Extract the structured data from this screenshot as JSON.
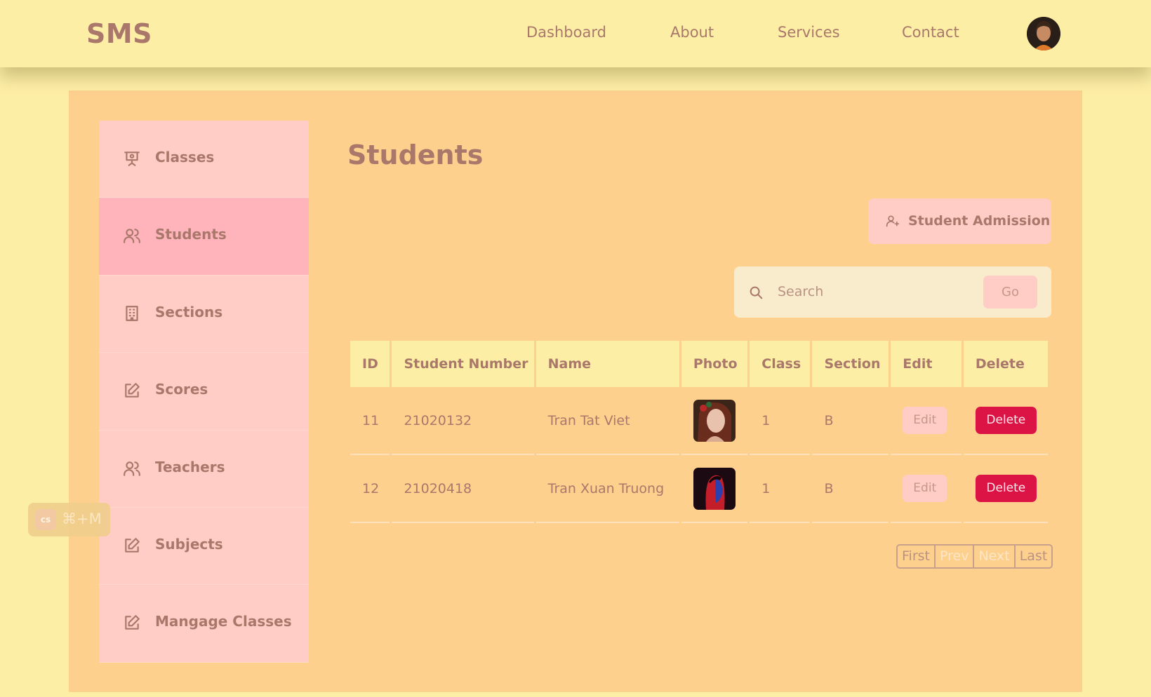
{
  "header": {
    "logo": "SMS",
    "nav": [
      "Dashboard",
      "About",
      "Services",
      "Contact"
    ]
  },
  "sidebar": {
    "items": [
      {
        "label": "Classes",
        "icon": "presentation-icon"
      },
      {
        "label": "Students",
        "icon": "users-icon",
        "active": true
      },
      {
        "label": "Sections",
        "icon": "building-icon"
      },
      {
        "label": "Scores",
        "icon": "edit-icon"
      },
      {
        "label": "Teachers",
        "icon": "users-icon"
      },
      {
        "label": "Subjects",
        "icon": "edit-icon"
      },
      {
        "label": "Mangage Classes",
        "icon": "edit-icon"
      }
    ]
  },
  "main": {
    "title": "Students",
    "admission_button": "Student Admission",
    "search": {
      "placeholder": "Search",
      "value": "",
      "button": "Go"
    },
    "table": {
      "columns": [
        "ID",
        "Student Number",
        "Name",
        "Photo",
        "Class",
        "Section",
        "Edit",
        "Delete"
      ],
      "rows": [
        {
          "id": "11",
          "number": "21020132",
          "name": "Tran Tat Viet",
          "class": "1",
          "section": "B",
          "edit": "Edit",
          "delete": "Delete"
        },
        {
          "id": "12",
          "number": "21020418",
          "name": "Tran Xuan Truong",
          "class": "1",
          "section": "B",
          "edit": "Edit",
          "delete": "Delete"
        }
      ]
    },
    "pagination": [
      "First",
      "Prev",
      "Next",
      "Last"
    ]
  },
  "shortcut": {
    "badge": "cs",
    "keys": "⌘+M"
  },
  "colors": {
    "background": "#fdeea6",
    "panel": "#fed08e",
    "sidebar_item": "#ffcdc6",
    "sidebar_active": "#ffb4bc",
    "text": "#a9786a",
    "delete": "#dc1446"
  }
}
